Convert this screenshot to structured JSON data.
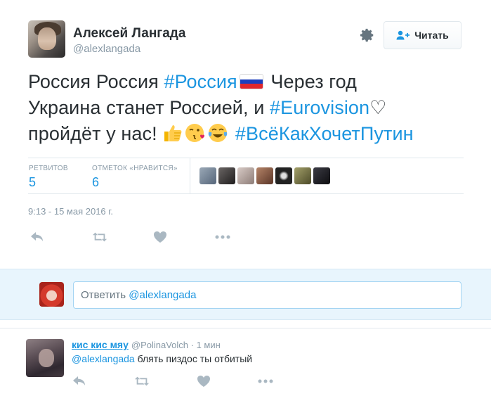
{
  "author": {
    "name": "Алексей Лангада",
    "handle": "@alexlangada"
  },
  "follow_button": {
    "label": "Читать",
    "icon": "add-user-icon"
  },
  "settings_icon": "gear-icon",
  "tweet": {
    "line1_a": "Россия Россия ",
    "line1_tag": "#Россия",
    "line1_flag": "russia-flag-emoji",
    "line1_b": " Через год",
    "line2_a": "Украина станет Россией, и ",
    "line2_tag": "#Eurovision",
    "line2_heart": "♡",
    "line3_a": "пройдёт у нас! ",
    "line3_emojis": [
      "thumbs-up-emoji",
      "face-blowing-kiss-emoji",
      "tears-of-joy-emoji"
    ],
    "line3_tag": "#ВсёКакХочетПутин"
  },
  "stats": {
    "retweets_label": "РЕТВИТОВ",
    "retweets": "5",
    "likes_label": "ОТМЕТОК «НРАВИТСЯ»",
    "likes": "6",
    "liker_colors": [
      "#6b7c8f",
      "#3d3a3a",
      "#b9aaa5",
      "#8a5f4c",
      "#2a2a2a",
      "#7d7a4e",
      "#1f1f24"
    ]
  },
  "timestamp": "9:13 - 15 мая 2016 г.",
  "action_icons": [
    "reply-icon",
    "retweet-icon",
    "heart-icon",
    "more-icon"
  ],
  "reply_box": {
    "prefix": "Ответить ",
    "mention": "@alexlangada"
  },
  "reply_tweet": {
    "name": "кис кис мяу",
    "handle": "@PolinaVolch",
    "time": " · 1 мин",
    "mention": "@alexlangada",
    "text": "  блять пиздос ты отбитый"
  },
  "colors": {
    "accent": "#1b95e0",
    "muted": "#8899a6",
    "text": "#292f33",
    "reply_bg": "#e8f5fd"
  }
}
